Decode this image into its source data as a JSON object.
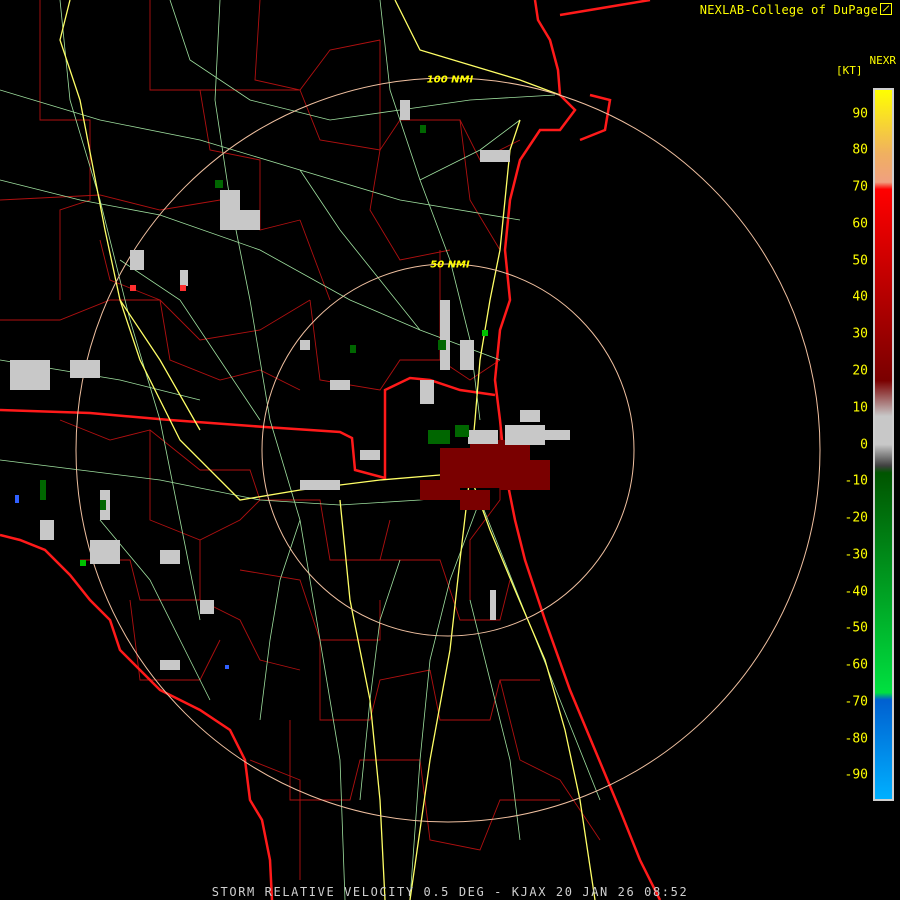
{
  "credit": "NEXLAB-College of DuPage",
  "product": "NEXR",
  "legend": {
    "unit": "[KT]",
    "ticks": [
      "90",
      "80",
      "70",
      "60",
      "50",
      "40",
      "30",
      "20",
      "10",
      "0",
      "-10",
      "-20",
      "-30",
      "-40",
      "-50",
      "-60",
      "-70",
      "-80",
      "-90"
    ],
    "tick_values": [
      90,
      80,
      70,
      60,
      50,
      40,
      30,
      20,
      10,
      0,
      -10,
      -20,
      -30,
      -40,
      -50,
      -60,
      -70,
      -80,
      -90
    ],
    "range": [
      -97,
      97
    ],
    "colors": {
      "top": "#ffff00",
      "orange": "#f0b060",
      "peach": "#f0a080",
      "red": "#ff0000",
      "darkred": "#7a0000",
      "gray": "#c8c8c8",
      "darkgreen": "#005500",
      "green": "#00e040",
      "blue": "#0060d0",
      "cyan": "#00b0ff"
    }
  },
  "rings": {
    "inner_label": "50 NMI",
    "outer_label": "100 NMI",
    "radii_nmi": [
      50,
      100
    ]
  },
  "map_colors": {
    "state_border": "#ff1a1a",
    "county_border": "#b01010",
    "highway": "#ffff66",
    "road": "#9fe09f",
    "range_ring": "#f0c0a0"
  },
  "footer": "STORM RELATIVE VELOCITY 0.5 DEG - KJAX 20 JAN 26 08:52"
}
